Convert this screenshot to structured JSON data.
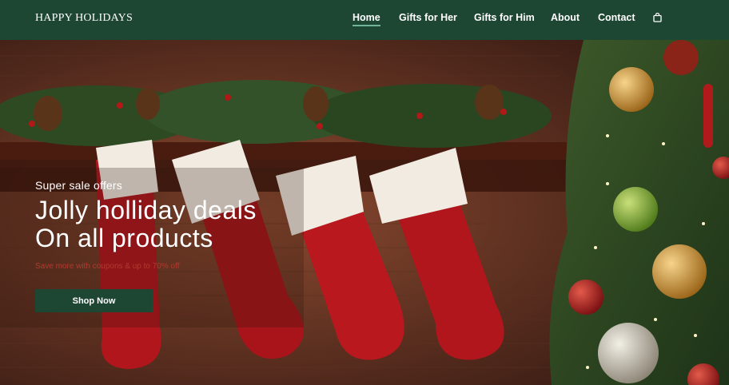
{
  "brand": "HAPPY HOLIDAYS",
  "nav": {
    "items": [
      {
        "label": "Home"
      },
      {
        "label": "Gifts for Her"
      },
      {
        "label": "Gifts for Him"
      },
      {
        "label": "About"
      },
      {
        "label": "Contact"
      }
    ],
    "active": "Home",
    "cart_icon": "shopping-bag-icon"
  },
  "hero": {
    "kicker": "Super sale offers",
    "headline_line1": "Jolly holliday deals",
    "headline_line2": "On all products",
    "subline": "Save more with coupons & up to 70% off",
    "cta_label": "Shop Now",
    "image": "christmas-stockings-mantel"
  },
  "colors": {
    "nav_bg": "#1d4633",
    "cta_bg": "#1d4633",
    "subline": "#b23a2e",
    "active_underline": "#6fb49a"
  }
}
